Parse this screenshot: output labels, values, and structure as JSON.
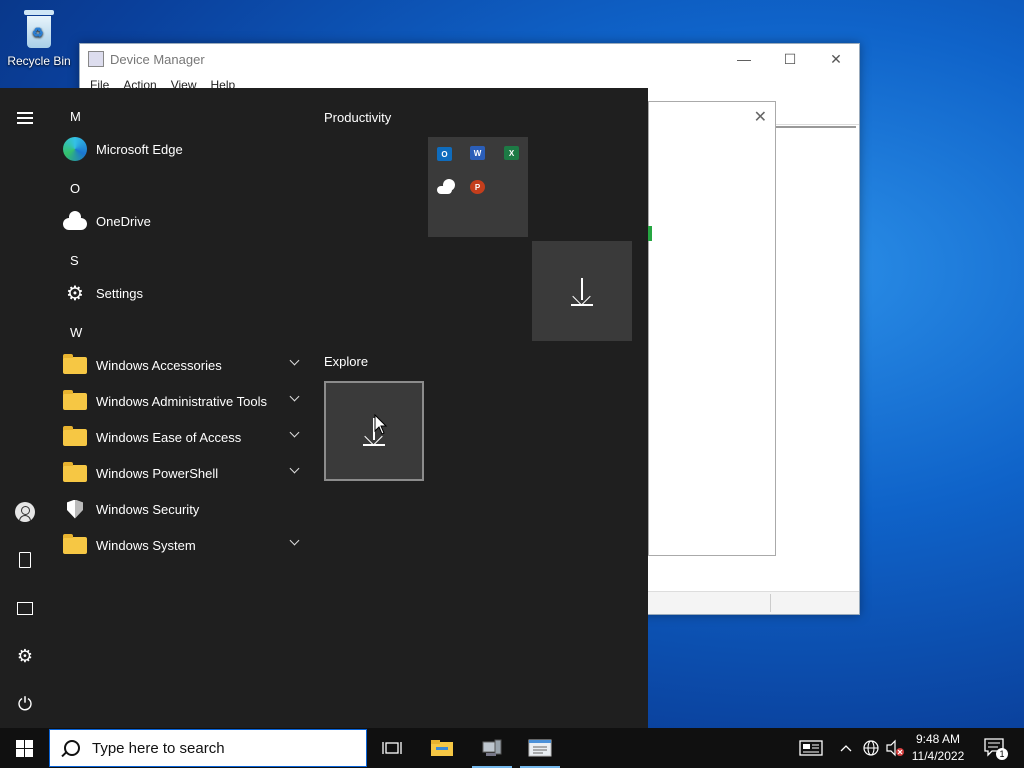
{
  "desktop": {
    "recycle_bin_label": "Recycle Bin"
  },
  "device_manager": {
    "title": "Device Manager",
    "menu": [
      "File",
      "Action",
      "View",
      "Help"
    ],
    "controls": {
      "minimize": "—",
      "maximize": "☐",
      "close": "✕"
    },
    "dialog_close": "✕"
  },
  "start_menu": {
    "letters": {
      "m": "M",
      "o": "O",
      "s": "S",
      "w": "W"
    },
    "apps": {
      "edge": "Microsoft Edge",
      "onedrive": "OneDrive",
      "settings": "Settings",
      "accessories": "Windows Accessories",
      "admin_tools": "Windows Administrative Tools",
      "ease_of_access": "Windows Ease of Access",
      "powershell": "Windows PowerShell",
      "security": "Windows Security",
      "system": "Windows System"
    },
    "groups": {
      "productivity": "Productivity",
      "explore": "Explore"
    },
    "mini_tiles": {
      "outlook": "O",
      "word": "W",
      "excel": "X",
      "powerpoint": "P"
    }
  },
  "taskbar": {
    "search_placeholder": "Type here to search",
    "time": "9:48 AM",
    "date": "11/4/2022",
    "notification_count": "1"
  },
  "colors": {
    "accent": "#0a64d8",
    "start_bg": "#1f1f1f",
    "tile_bg": "#3a3a3a",
    "taskbar_bg": "#101010"
  }
}
